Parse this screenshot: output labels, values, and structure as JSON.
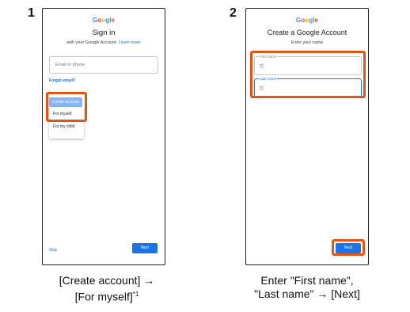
{
  "colors": {
    "highlight": "#e25513",
    "primary": "#1a73e8",
    "google_blue": "#4285F4",
    "google_red": "#EA4335",
    "google_yellow": "#FBBC05",
    "google_green": "#34A853"
  },
  "step1": {
    "number": "1",
    "logo": [
      "G",
      "o",
      "o",
      "g",
      "l",
      "e"
    ],
    "title": "Sign in",
    "subtitle": "with your Google Account.",
    "learn_more": "Learn more",
    "email_placeholder": "Email or phone",
    "forgot_email": "Forgot email?",
    "create_account": "Create account",
    "menu": [
      "For myself",
      "For my child"
    ],
    "skip": "Skip",
    "next": "Next",
    "caption_line1": "[Create account] →",
    "caption_line2": "[For myself]",
    "caption_footnote": "*1"
  },
  "step2": {
    "number": "2",
    "logo": [
      "G",
      "o",
      "o",
      "g",
      "l",
      "e"
    ],
    "title": "Create a Google Account",
    "subtitle": "Enter your name",
    "first_name_label": "First name",
    "last_name_label": "Last name",
    "ime_icon_first": "㍿",
    "ime_icon_last": "㍿",
    "next": "Next",
    "caption_line1": "Enter \"First name\",",
    "caption_line2": "\"Last name\" → [Next]"
  }
}
